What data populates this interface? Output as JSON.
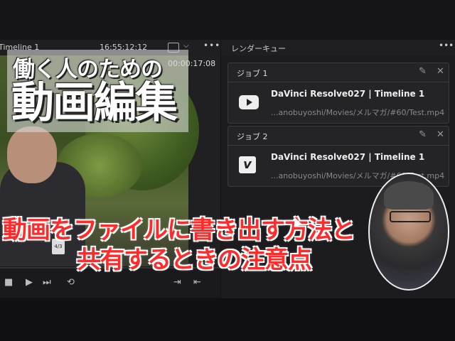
{
  "viewer": {
    "timeline_label": "Timeline 1",
    "timecode": "16:55:12:12",
    "chevron": "⌵",
    "dots": "•••",
    "overlay_timecode": "00:00:17:08",
    "badge": "4/3"
  },
  "title_card": {
    "line1": "働く人のための",
    "line2": "動画編集"
  },
  "caption": {
    "line1": "動画をファイルに書き出す方法と",
    "line2": "共有するときの注意点"
  },
  "controls": {
    "stop": "■",
    "play": "▶",
    "skip": "⏭",
    "loop": "⟲",
    "mark_in": "⇥",
    "mark_out": "⇤"
  },
  "render_queue": {
    "title": "レンダーキュー",
    "dots": "•••",
    "jobs": [
      {
        "label": "ジョブ 1",
        "title": "DaVinci Resolve027 | Timeline 1",
        "path": "...anobuyoshi/Movies/メルマガ/#60/Test.mp4",
        "icon": "youtube-icon"
      },
      {
        "label": "ジョブ 2",
        "title": "DaVinci Resolve027 | Timeline 1",
        "path": "...anobuyoshi/Movies/メルマガ/#60/Test.mp4",
        "icon": "vimeo-icon"
      }
    ],
    "edit_glyph": "✎",
    "close_glyph": "✕",
    "vimeo_glyph": "v"
  }
}
